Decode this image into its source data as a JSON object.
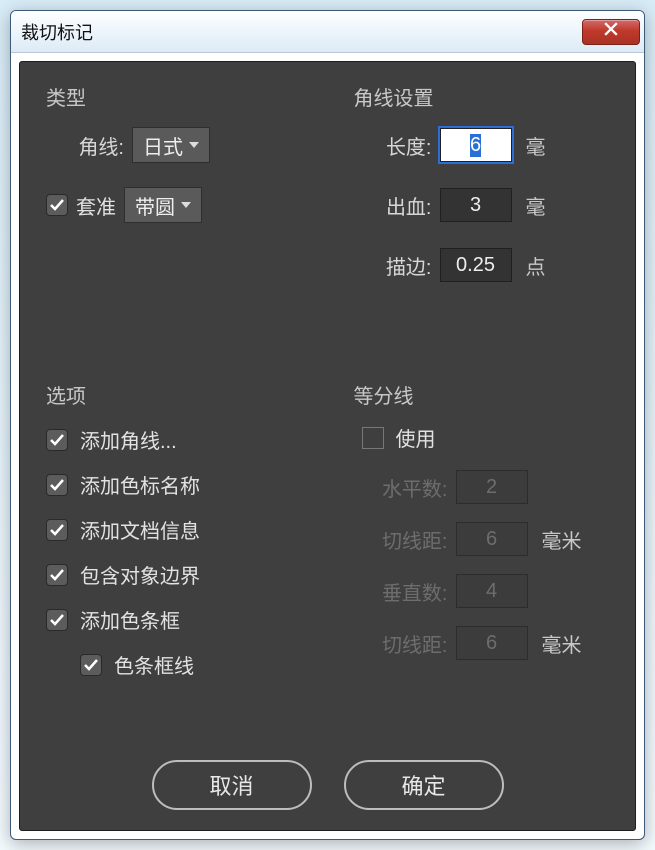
{
  "window": {
    "title": "裁切标记"
  },
  "type_panel": {
    "title": "类型",
    "corner_label": "角线:",
    "corner_value": "日式",
    "register_checked": true,
    "register_label": "套准",
    "register_value": "带圆"
  },
  "corner_settings_panel": {
    "title": "角线设置",
    "length_label": "长度:",
    "length_value": "6",
    "length_unit": "毫",
    "bleed_label": "出血:",
    "bleed_value": "3",
    "bleed_unit": "毫",
    "stroke_label": "描边:",
    "stroke_value": "0.25",
    "stroke_unit": "点"
  },
  "options_panel": {
    "title": "选项",
    "add_corner": {
      "checked": true,
      "label": "添加角线..."
    },
    "add_swatch_name": {
      "checked": true,
      "label": "添加色标名称"
    },
    "add_doc_info": {
      "checked": true,
      "label": "添加文档信息"
    },
    "include_bounds": {
      "checked": true,
      "label": "包含对象边界"
    },
    "add_colorbar": {
      "checked": true,
      "label": "添加色条框"
    },
    "colorbar_lines": {
      "checked": true,
      "label": "色条框线"
    }
  },
  "division_panel": {
    "title": "等分线",
    "use_label": "使用",
    "use_checked": false,
    "h_count_label": "水平数:",
    "h_count_value": "2",
    "h_dist_label": "切线距:",
    "h_dist_value": "6",
    "h_dist_unit": "毫米",
    "v_count_label": "垂直数:",
    "v_count_value": "4",
    "v_dist_label": "切线距:",
    "v_dist_value": "6",
    "v_dist_unit": "毫米"
  },
  "footer": {
    "cancel": "取消",
    "ok": "确定"
  }
}
